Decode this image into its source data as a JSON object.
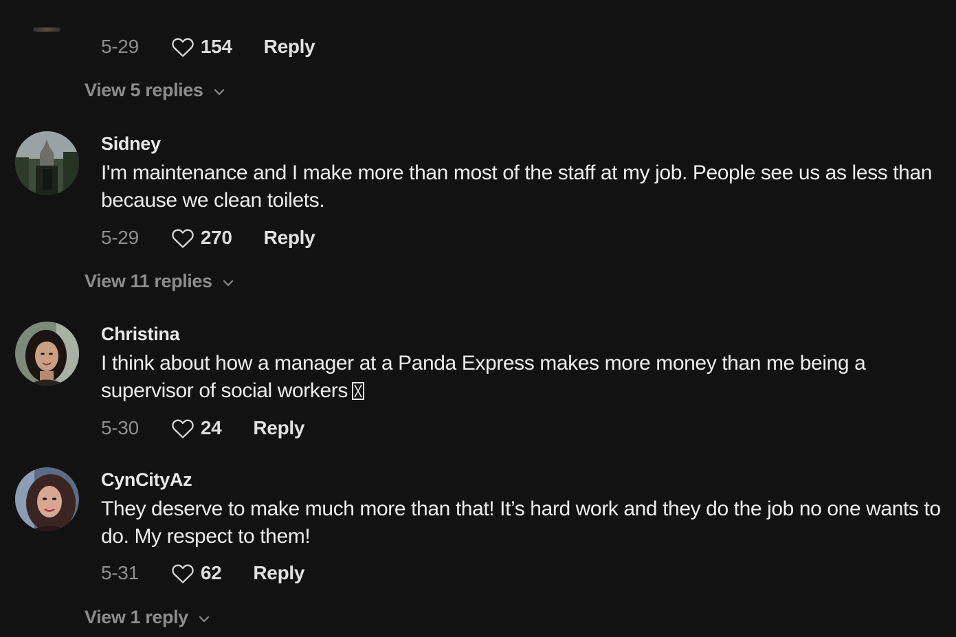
{
  "comments": [
    {
      "date": "5-29",
      "likes": "154",
      "reply_label": "Reply",
      "view_replies": "View 5 replies"
    },
    {
      "username": "Sidney",
      "text": "I'm maintenance and I make more than most of the staff at my job. People see us as less than because we clean toilets.",
      "date": "5-29",
      "likes": "270",
      "reply_label": "Reply",
      "view_replies": "View 11 replies"
    },
    {
      "username": "Christina",
      "text": "I think about how a manager at a Panda Express makes more money than me being a supervisor of social workers",
      "date": "5-30",
      "likes": "24",
      "reply_label": "Reply"
    },
    {
      "username": "CynCityAz",
      "text": "They deserve to make much more than that! It’s hard work and they do the job no one wants to do. My respect to them!",
      "date": "5-31",
      "likes": "62",
      "reply_label": "Reply",
      "view_replies": "View 1 reply"
    }
  ],
  "icons": {
    "like": "heart-outline-icon",
    "expand": "chevron-down-icon"
  },
  "colors": {
    "background": "#121212",
    "primary_text": "#ededed",
    "secondary_text": "#8e8e8e"
  }
}
